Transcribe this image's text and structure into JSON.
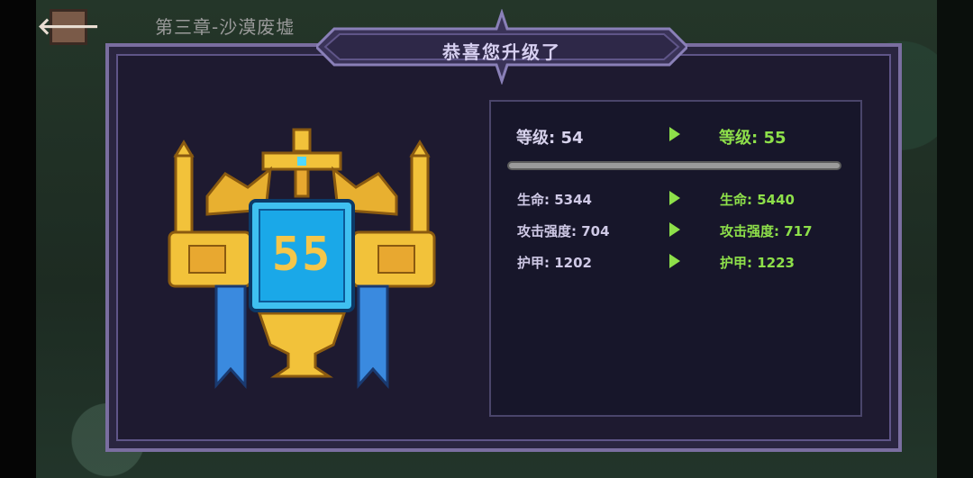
{
  "header": {
    "back_icon": "arrow-left-icon",
    "chapter_title": "第三章-沙漠废墟"
  },
  "dialog": {
    "title": "恭喜您升级了"
  },
  "badge": {
    "level_number": "55"
  },
  "stats": {
    "level_old": "等级: 54",
    "level_new": "等级: 55",
    "rows": [
      {
        "old": "生命: 5344",
        "new": "生命: 5440"
      },
      {
        "old": "攻击强度: 704",
        "new": "攻击强度: 717"
      },
      {
        "old": "护甲: 1202",
        "new": "护甲: 1223"
      }
    ]
  },
  "colors": {
    "accent_green": "#8ee04a",
    "panel_border": "#7a6ea0",
    "panel_bg": "#1e1a30"
  }
}
